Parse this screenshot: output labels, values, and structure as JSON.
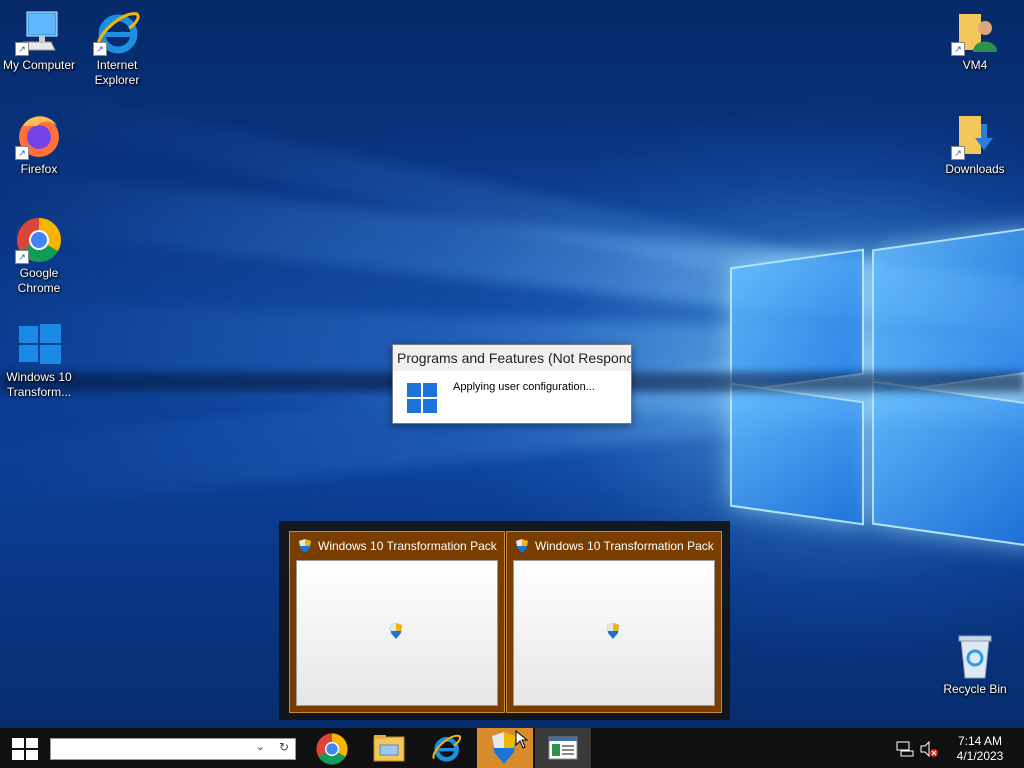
{
  "desktop": {
    "icons_left": [
      {
        "label": "My Computer",
        "icon": "computer-icon"
      },
      {
        "label": "Internet Explorer",
        "icon": "internet-explorer-icon"
      },
      {
        "label": "Firefox",
        "icon": "firefox-icon"
      },
      {
        "label": "Google Chrome",
        "icon": "chrome-icon"
      },
      {
        "label": "Windows 10 Transform...",
        "icon": "windows-logo-icon"
      }
    ],
    "icons_right": [
      {
        "label": "VM4",
        "icon": "user-folder-icon"
      },
      {
        "label": "Downloads",
        "icon": "downloads-folder-icon"
      },
      {
        "label": "Recycle Bin",
        "icon": "recycle-bin-icon"
      }
    ]
  },
  "dialog": {
    "title": "Programs and Features (Not Responding)",
    "message": "Applying user configuration..."
  },
  "thumbnails": [
    {
      "title": "Windows 10 Transformation Pack"
    },
    {
      "title": "Windows 10 Transformation Pack"
    }
  ],
  "taskbar": {
    "search_value": "",
    "buttons": [
      "chrome-icon",
      "file-explorer-icon",
      "internet-explorer-icon",
      "uac-shield-icon",
      "window-icon"
    ],
    "clock_time": "7:14 AM",
    "clock_date": "4/1/2023"
  },
  "colors": {
    "taskbar": "#101010",
    "active_task": "#d98a2b",
    "thumb_bg": "#7a3d00",
    "accent_blue": "#1b74d9"
  }
}
